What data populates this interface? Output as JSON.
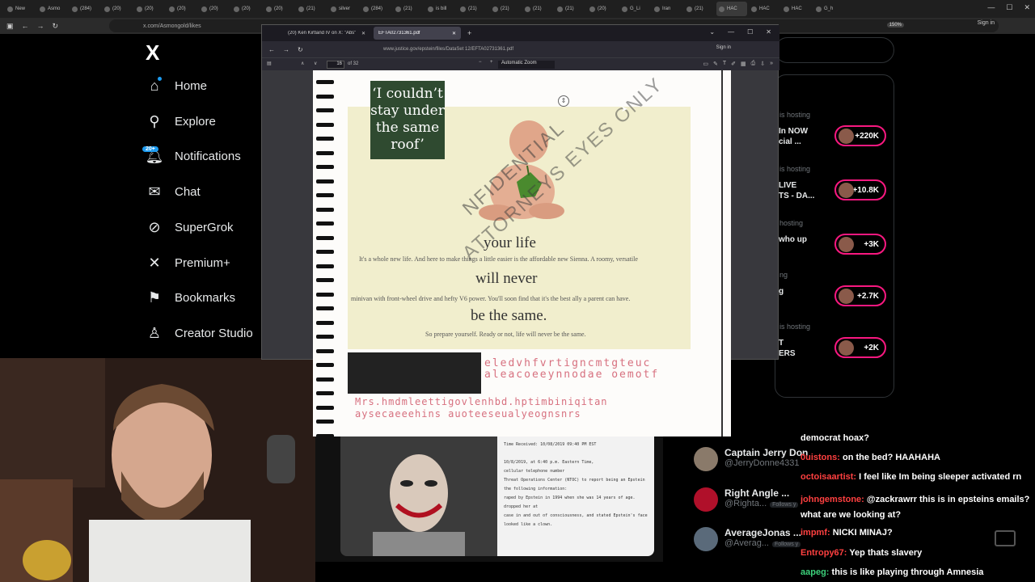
{
  "outer_browser": {
    "tabs": [
      "New",
      "Asmo",
      "(284)",
      "(20)",
      "(20)",
      "(20)",
      "(20)",
      "(20)",
      "(20)",
      "(21)",
      "silver",
      "(284)",
      "(21)",
      "is bill",
      "(21)",
      "(21)",
      "(21)",
      "(21)",
      "(20)",
      "G_Li",
      "Iran",
      "(21)",
      "HAC",
      "HAC",
      "HAC",
      "G_h"
    ],
    "url": "x.com/Asmongold/likes",
    "zoom": "150%",
    "sign_in": "Sign in"
  },
  "x_sidebar": {
    "logo": "X",
    "notifications_badge": "20+",
    "items": [
      {
        "label": "Home",
        "icon": "home-icon"
      },
      {
        "label": "Explore",
        "icon": "search-icon"
      },
      {
        "label": "Notifications",
        "icon": "bell-icon"
      },
      {
        "label": "Chat",
        "icon": "mail-icon"
      },
      {
        "label": "SuperGrok",
        "icon": "grok-icon"
      },
      {
        "label": "Premium+",
        "icon": "x-icon"
      },
      {
        "label": "Bookmarks",
        "icon": "bookmark-icon"
      },
      {
        "label": "Creator Studio",
        "icon": "creator-icon"
      }
    ]
  },
  "hosting_panel": {
    "entries": [
      {
        "label": "is hosting",
        "title": "In NOW\ncial ...",
        "count": "+220K"
      },
      {
        "label": "is hosting",
        "title": "LIVE\nTS - DA...",
        "count": "+10.8K"
      },
      {
        "label": "hosting",
        "title": "who up",
        "count": "+3K"
      },
      {
        "label": "ng",
        "title": "g",
        "count": "+2.7K"
      },
      {
        "label": "is hosting",
        "title": "T\nERS",
        "count": "+2K"
      }
    ]
  },
  "pdf_window": {
    "tabs": [
      {
        "label": "(20) Ken Kirtland IV on X: \"Abs\""
      },
      {
        "label": "EFTA02731361.pdf"
      }
    ],
    "url": "www.justice.gov/epstein/files/DataSet 12/EFTA02731361.pdf",
    "sign_in": "Sign in",
    "page_number": "16",
    "page_total": "of 32",
    "zoom": "Automatic Zoom"
  },
  "scanned_page": {
    "quote": [
      "‘I couldn’t",
      "stay under",
      "the same",
      "roof’"
    ],
    "headline1": "your life",
    "headline2": "will never",
    "headline3": "be the same.",
    "body1": "It's a whole new life. And here to make things a little easier is the affordable new Sienna. A roomy, versatile",
    "body2": "minivan with front-wheel drive and hefty V6 power. You'll soon find that it's the best ally a parent can have.",
    "body3": "So prepare yourself. Ready or not, life will never be the same.",
    "stamp1": "NFIDENTIAL",
    "stamp2": "ATTORNEYS EYES ONLY",
    "hand1": "eledvhfvrtigncmtgteuc",
    "hand2": "aleacoeeynnodae oemotf",
    "hand3": "Mrs.hmdmleettigovlenhbd.hptimbiniqitan",
    "hand4": "aysecaeeehins auoteeseualyeognsnrs"
  },
  "doc_below": {
    "received": "Time Received: 10/08/2019 09:40 PM EST",
    "lines": [
      "10/8/2019, at 6:40 p.m. Eastern Time,",
      "cellular telephone number",
      "Threat Operations Center (NTOC) to report being an Epstein",
      "the following information:",
      "raped by Epstein in 1994 when she was 14 years of age.",
      "dropped her at",
      "case in and out of consciousness, and stated Epstein's face",
      "looked like a clown."
    ]
  },
  "suggestions": [
    {
      "name": "Captain Jerry Don",
      "handle": "@JerryDonne4331",
      "follows": ""
    },
    {
      "name": "Right Angle ...",
      "handle": "@Righta...",
      "follows": "Follows y"
    },
    {
      "name": "AverageJonas ...",
      "handle": "@Averag...",
      "follows": "Follows y"
    }
  ],
  "chat": [
    {
      "user": "",
      "text": "democrat hoax?",
      "color": "#ffffff"
    },
    {
      "user": "0uistons:",
      "text": "on the bed? HAAHAHA",
      "color": "#ff4040"
    },
    {
      "user": "octoisaartist:",
      "text": "I feel like Im being sleeper activated rn",
      "color": "#ff4040"
    },
    {
      "user": "johngemstone:",
      "text": "@zackrawrr this is in epsteins emails? what are we looking at?",
      "color": "#ff4040"
    },
    {
      "user": "impmf:",
      "text": "NICKI MINAJ?",
      "color": "#ff4040"
    },
    {
      "user": "Entropy67:",
      "text": "Yep thats slavery",
      "color": "#ff4040"
    },
    {
      "user": "aapeg:",
      "text": "this is like playing through Amnesia",
      "color": "#3cd07a"
    }
  ]
}
